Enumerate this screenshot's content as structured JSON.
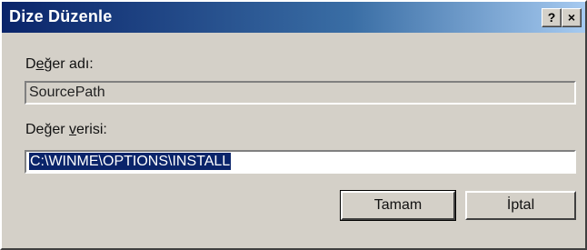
{
  "window": {
    "title": "Dize Düzenle",
    "help_button": "?",
    "close_button": "×"
  },
  "value_name": {
    "label_prefix": "D",
    "label_ul": "e",
    "label_rest": "ğer adı:",
    "value": "SourcePath"
  },
  "value_data": {
    "label_prefix": "Değer ",
    "label_ul": "v",
    "label_rest": "erisi:",
    "value": "C:\\WINME\\OPTIONS\\INSTALL"
  },
  "buttons": {
    "ok": "Tamam",
    "cancel": "İptal"
  },
  "colors": {
    "title_start": "#0a246a",
    "title_end": "#a6caf0",
    "face": "#d4d0c8",
    "selection": "#0a246a"
  }
}
